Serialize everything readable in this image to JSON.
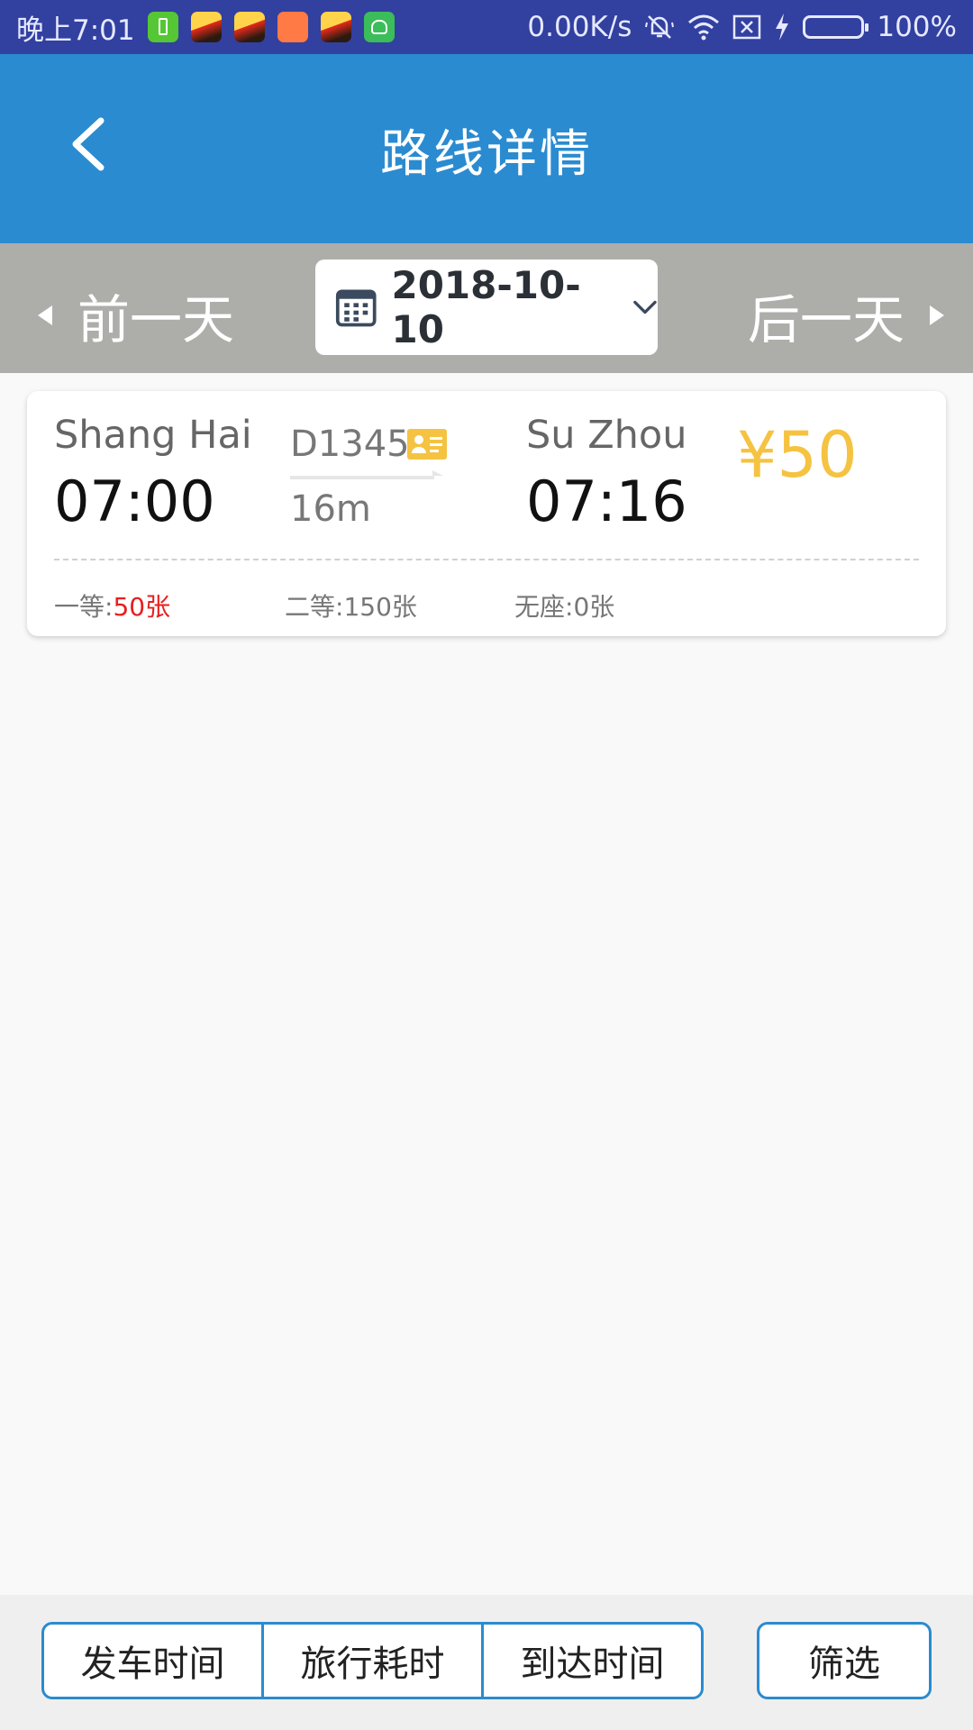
{
  "status_bar": {
    "time": "晚上7:01",
    "network_speed": "0.00K/s",
    "battery_percent": "100%",
    "icons": [
      "battery-app-icon",
      "sohu-app-icon",
      "sohu-app-icon",
      "mi-app-icon",
      "sohu-app-icon",
      "android-app-icon",
      "mute-vibrate-icon",
      "wifi-icon",
      "no-sim-icon",
      "charging-icon",
      "battery-icon"
    ]
  },
  "header": {
    "title": "路线详情",
    "back_icon": "chevron-left-icon"
  },
  "date_bar": {
    "prev_label": "前一天",
    "next_label": "后一天",
    "date": "2018-10-10",
    "calendar_icon": "calendar-icon",
    "dropdown_icon": "chevron-down-icon"
  },
  "trains": [
    {
      "from_city": "Shang Hai",
      "depart_time": "07:00",
      "train_no": "D1345",
      "duration": "16m",
      "to_city": "Su Zhou",
      "arrive_time": "07:16",
      "price": "¥50",
      "seats": [
        {
          "label": "一等:",
          "count": "50张"
        },
        {
          "label": "二等:",
          "count": "150张"
        },
        {
          "label": "无座:",
          "count": "0张"
        }
      ]
    }
  ],
  "bottom": {
    "sort_depart": "发车时间",
    "sort_duration": "旅行耗时",
    "sort_arrive": "到达时间",
    "filter": "筛选"
  },
  "colors": {
    "status_bar": "#3240a0",
    "primary": "#2a8bd0",
    "date_bar": "#adadaa",
    "price": "#f5c341",
    "highlight": "#e81e1e"
  }
}
